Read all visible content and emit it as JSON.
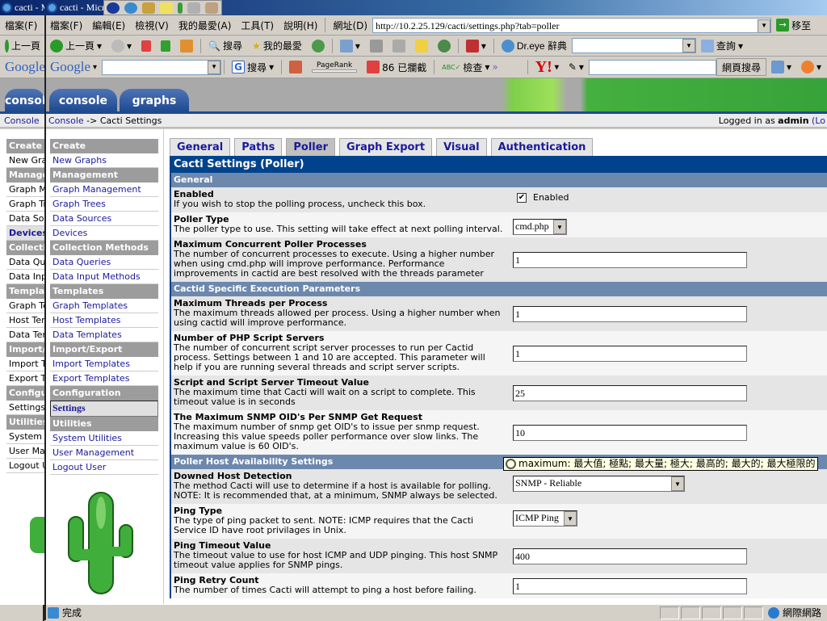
{
  "window": {
    "tabs": [
      "cacti - M",
      "cacti - Micr"
    ]
  },
  "menubar": {
    "background_item": "檔案(F)",
    "items": [
      "檔案(F)",
      "編輯(E)",
      "檢視(V)",
      "我的最愛(A)",
      "工具(T)",
      "說明(H)"
    ],
    "address_label": "網址(D)",
    "address": "http://10.2.25.129/cacti/settings.php?tab=poller",
    "go_label": "移至"
  },
  "toolbar": {
    "back_bg": "上一頁",
    "back": "上一頁",
    "search": "搜尋",
    "favorites": "我的最愛",
    "dreye": "Dr.eye 辭典",
    "lookup": "查詢"
  },
  "google_bar": {
    "logo": "Google",
    "search": "搜尋",
    "pagerank": "PageRank",
    "blocked": "86 已攔截",
    "check": "檢查",
    "more": "»",
    "web_search": "網頁搜尋"
  },
  "nav_tabs": [
    "console",
    "graphs"
  ],
  "breadcrumb": {
    "bg": "Console",
    "root": "Console",
    "sep": " -> ",
    "current": "Cacti Settings"
  },
  "login": {
    "prefix": "Logged in as ",
    "user": "admin",
    "suffix": " (Lo"
  },
  "sidebar": [
    {
      "type": "h",
      "label": "Create"
    },
    {
      "type": "i",
      "label": "New Graphs"
    },
    {
      "type": "h",
      "label": "Management"
    },
    {
      "type": "i",
      "label": "Graph Management"
    },
    {
      "type": "i",
      "label": "Graph Trees"
    },
    {
      "type": "i",
      "label": "Data Sources"
    },
    {
      "type": "i",
      "label": "Devices"
    },
    {
      "type": "h",
      "label": "Collection Methods"
    },
    {
      "type": "i",
      "label": "Data Queries"
    },
    {
      "type": "i",
      "label": "Data Input Methods"
    },
    {
      "type": "h",
      "label": "Templates"
    },
    {
      "type": "i",
      "label": "Graph Templates"
    },
    {
      "type": "i",
      "label": "Host Templates"
    },
    {
      "type": "i",
      "label": "Data Templates"
    },
    {
      "type": "h",
      "label": "Import/Export"
    },
    {
      "type": "i",
      "label": "Import Templates"
    },
    {
      "type": "i",
      "label": "Export Templates"
    },
    {
      "type": "h",
      "label": "Configuration"
    },
    {
      "type": "i",
      "label": "Settings",
      "selected": true
    },
    {
      "type": "h",
      "label": "Utilities"
    },
    {
      "type": "i",
      "label": "System Utilities"
    },
    {
      "type": "i",
      "label": "User Management"
    },
    {
      "type": "i",
      "label": "Logout User"
    }
  ],
  "settings_tabs": [
    {
      "label": "General"
    },
    {
      "label": "Paths"
    },
    {
      "label": "Poller",
      "active": true
    },
    {
      "label": "Graph Export"
    },
    {
      "label": "Visual"
    },
    {
      "label": "Authentication"
    }
  ],
  "title": "Cacti Settings (Poller)",
  "sections": [
    {
      "header": "General",
      "rows": [
        {
          "name": "Enabled",
          "desc": "If you wish to stop the polling process, uncheck this box.",
          "control": "checkbox",
          "checked": true,
          "value": "Enabled"
        },
        {
          "name": "Poller Type",
          "desc": "The poller type to use. This setting will take effect at next polling interval.",
          "control": "select",
          "value": "cmd.php"
        },
        {
          "name": "Maximum Concurrent Poller Processes",
          "desc": "The number of concurrent processes to execute. Using a higher number when using cmd.php will improve performance. Performance improvements in cactid are best resolved with the threads parameter",
          "control": "text",
          "value": "1"
        }
      ]
    },
    {
      "header": "Cactid Specific Execution Parameters",
      "rows": [
        {
          "name": "Maximum Threads per Process",
          "desc": "The maximum threads allowed per process. Using a higher number when using cactid will improve performance.",
          "control": "text",
          "value": "1"
        },
        {
          "name": "Number of PHP Script Servers",
          "desc": "The number of concurrent script server processes to run per Cactid process. Settings between 1 and 10 are accepted. This parameter will help if you are running several threads and script server scripts.",
          "control": "text",
          "value": "1"
        },
        {
          "name": "Script and Script Server Timeout Value",
          "desc": "The maximum time that Cacti will wait on a script to complete. This timeout value is in seconds",
          "control": "text",
          "value": "25"
        },
        {
          "name": "The Maximum SNMP OID's Per SNMP Get Request",
          "desc": "The maximum number of snmp get OID's to issue per snmp request. Increasing this value speeds poller performance over slow links. The maximum value is 60 OID's.",
          "control": "text",
          "value": "10"
        }
      ]
    },
    {
      "header": "Poller Host Availability Settings",
      "rows": [
        {
          "name": "Downed Host Detection",
          "desc": "The method Cacti will use to determine if a host is available for polling. NOTE: It is recommended that, at a minimum, SNMP always be selected.",
          "control": "select",
          "value": "SNMP - Reliable",
          "wide": true
        },
        {
          "name": "Ping Type",
          "desc": "The type of ping packet to sent. NOTE: ICMP requires that the Cacti Service ID have root privilages in Unix.",
          "control": "select",
          "value": "ICMP Ping"
        },
        {
          "name": "Ping Timeout Value",
          "desc": "The timeout value to use for host ICMP and UDP pinging. This host SNMP timeout value applies for SNMP pings.",
          "control": "text",
          "value": "400"
        },
        {
          "name": "Ping Retry Count",
          "desc": "The number of times Cacti will attempt to ping a host before failing.",
          "control": "text",
          "value": "1"
        }
      ]
    }
  ],
  "tooltip": "maximum: 最大值; 極點; 最大量; 極大; 最高的; 最大的; 最大極限的",
  "status": {
    "text": "完成",
    "zone": "網際網路"
  },
  "colors": {
    "header_blue": "#00438c",
    "section": "#6d88ad",
    "link": "#1a1a9a"
  }
}
